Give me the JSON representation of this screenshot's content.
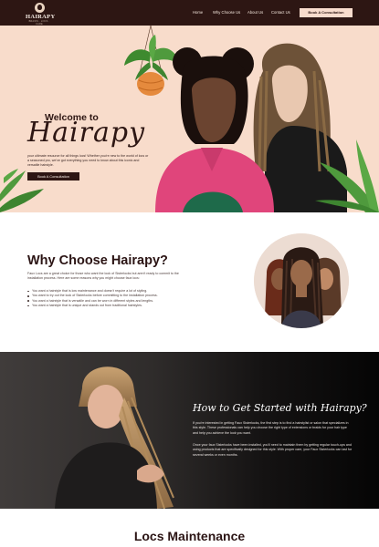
{
  "nav": {
    "logo_text": "HAIRAPY",
    "logo_subtext": "BRAIDS · LOCS · CARE",
    "items": [
      {
        "label": "Home"
      },
      {
        "label": "Why Choose Us"
      },
      {
        "label": "About Us"
      },
      {
        "label": "Contact Us"
      }
    ],
    "cta": "Book A Consultation"
  },
  "hero": {
    "welcome": "Welcome to",
    "brand": "Hairapy",
    "description": "your ultimate resource for all things locs! Whether you're new to the world of locs or a seasoned pro, we've got everything you need to know about this iconic and versatile hairstyle.",
    "button": "Book A Consultation"
  },
  "why": {
    "title": "Why Choose Hairapy?",
    "intro": "Faux Locs are a great choice for those who want the look of Sisterlocks but aren't ready to commit to the installation process. Here are some reasons why you might choose faux locs:",
    "reasons": [
      "You want a hairstyle that is low maintenance and doesn't require a lot of styling.",
      "You want to try out the look of Sisterlocks before committing to the installation process.",
      "You want a hairstyle that is versatile and can be worn in different styles and lengths.",
      "You want a hairstyle that is unique and stands out from traditional hairstyles."
    ]
  },
  "get_started": {
    "title": "How to Get Started with Hairapy?",
    "paragraph1": "If you're interested in getting Faux Sisterlocks, the first step is to find a hairstylist or salon that specializes in this style. These professionals can help you choose the right type of extensions or braids for your hair type and help you achieve the look you want.",
    "paragraph2": "Once your faux Sisterlocks have been installed, you'll need to maintain them by getting regular touch-ups and using products that are specifically designed for this style. With proper care, your Faux Sisterlocks can last for several weeks or even months."
  },
  "locs": {
    "title": "Locs Maintenance"
  },
  "colors": {
    "brand_dark": "#2d1613",
    "hero_bg": "#f8dccb",
    "cta_bg": "#f8dccd",
    "accent_pink": "#e0457b",
    "plant_green": "#4f9a3d"
  },
  "icons": [
    "hairapy-logo-icon",
    "hanging-plant-icon",
    "leaf-icon",
    "bullet-icon"
  ]
}
